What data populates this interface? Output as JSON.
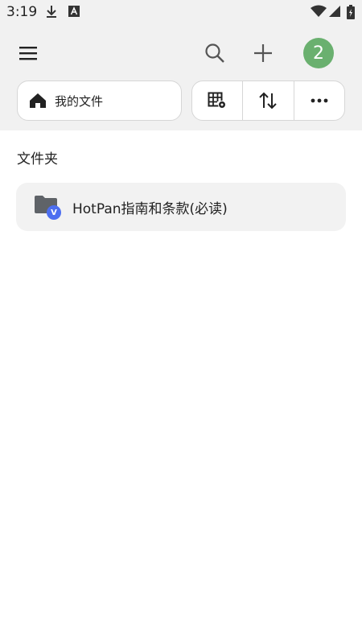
{
  "status_bar": {
    "time": "3:19",
    "icons": [
      "download-icon",
      "app-notification-icon",
      "wifi-icon",
      "signal-icon",
      "battery-icon"
    ]
  },
  "header": {
    "menu_icon": "menu-icon",
    "search_icon": "search-icon",
    "add_icon": "plus-icon",
    "avatar_label": "2",
    "avatar_color": "#6ab06f"
  },
  "breadcrumb": {
    "icon": "home-icon",
    "label": "我的文件"
  },
  "toolbar": {
    "items": [
      {
        "icon": "grid-settings-icon"
      },
      {
        "icon": "sort-icon"
      },
      {
        "icon": "more-icon"
      }
    ]
  },
  "main": {
    "section_title": "文件夹",
    "folders": [
      {
        "name": "HotPan指南和条款(必读)",
        "badge": "V",
        "badge_color": "#4c6ef0"
      }
    ]
  }
}
